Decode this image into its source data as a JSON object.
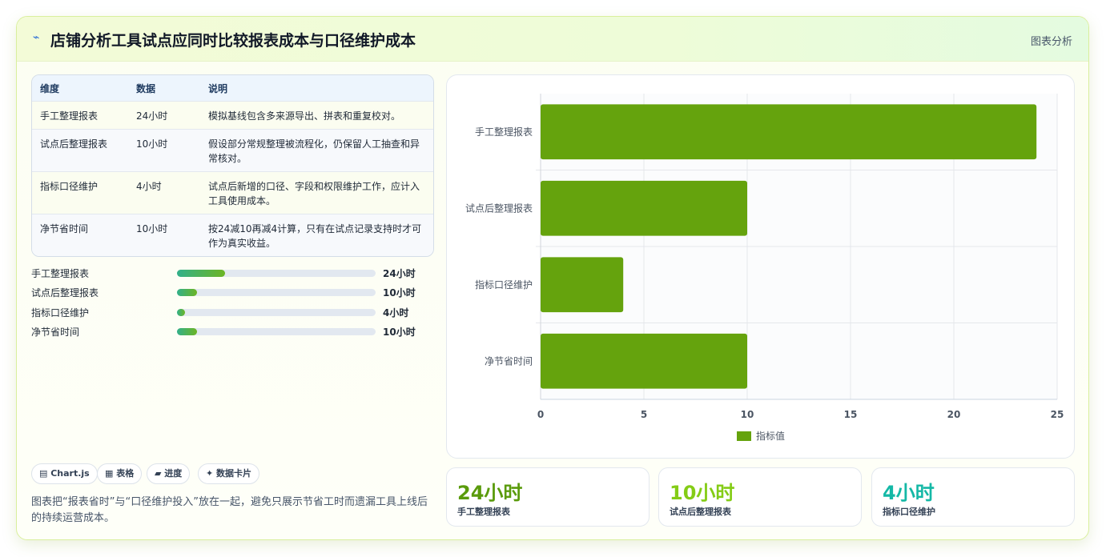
{
  "header": {
    "icon": "lightning-icon",
    "title": "店铺分析工具试点应同时比较报表成本与口径维护成本",
    "tag": "图表分析"
  },
  "table": {
    "columns": [
      "维度",
      "数据",
      "说明"
    ],
    "rows": [
      [
        "手工整理报表",
        "24小时",
        "模拟基线包含多来源导出、拼表和重复校对。"
      ],
      [
        "试点后整理报表",
        "10小时",
        "假设部分常规整理被流程化，仍保留人工抽查和异常核对。"
      ],
      [
        "指标口径维护",
        "4小时",
        "试点后新增的口径、字段和权限维护工作，应计入工具使用成本。"
      ],
      [
        "净节省时间",
        "10小时",
        "按24减10再减4计算，只有在试点记录支持时才可作为真实收益。"
      ]
    ]
  },
  "progress": {
    "max": 100,
    "items": [
      {
        "label": "手工整理报表",
        "value": 24,
        "display": "24小时"
      },
      {
        "label": "试点后整理报表",
        "value": 10,
        "display": "10小时"
      },
      {
        "label": "指标口径维护",
        "value": 4,
        "display": "4小时"
      },
      {
        "label": "净节省时间",
        "value": 10,
        "display": "10小时"
      }
    ]
  },
  "chips": [
    "▤ Chart.js",
    "▦ 表格",
    "▰ 进度",
    "✦ 数据卡片"
  ],
  "note": "图表把“报表省时”与“口径维护投入”放在一起，避免只展示节省工时而遗漏工具上线后的持续运营成本。",
  "kpis": [
    {
      "value": "24小时",
      "label": "手工整理报表",
      "color": "#5a9b0c"
    },
    {
      "value": "10小时",
      "label": "试点后整理报表",
      "color": "#84cc16"
    },
    {
      "value": "4小时",
      "label": "指标口径维护",
      "color": "#14b8a6"
    }
  ],
  "chart_data": {
    "type": "bar",
    "orientation": "horizontal",
    "categories": [
      "手工整理报表",
      "试点后整理报表",
      "指标口径维护",
      "净节省时间"
    ],
    "series": [
      {
        "name": "指标值",
        "values": [
          24,
          10,
          4,
          10
        ],
        "color": "#65a30d"
      }
    ],
    "xlim": [
      0,
      25
    ],
    "xticks": [
      0,
      5,
      10,
      15,
      20,
      25
    ],
    "grid": true,
    "legend": "bottom"
  }
}
